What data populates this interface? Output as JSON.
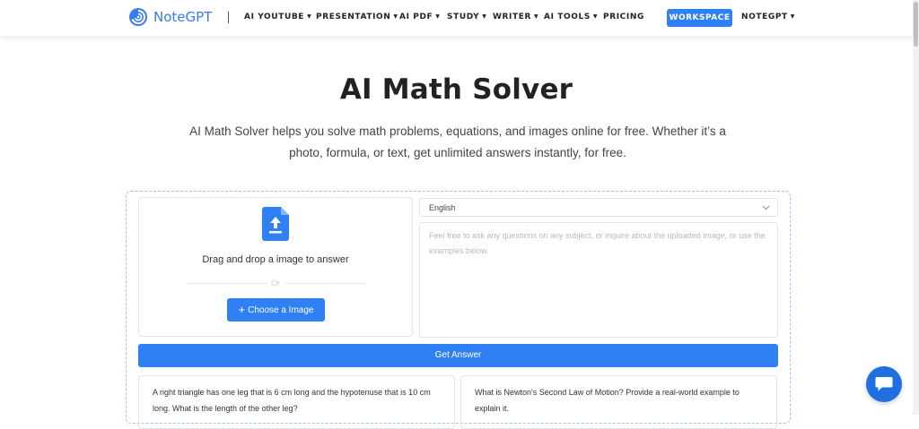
{
  "brand": {
    "name": "NoteGPT",
    "accent": "#2f80f5"
  },
  "nav": {
    "items": [
      {
        "label": "AI YOUTUBE",
        "dropdown": true
      },
      {
        "label": "PRESENTATION",
        "dropdown": true
      },
      {
        "label": "AI PDF",
        "dropdown": true
      },
      {
        "label": "STUDY",
        "dropdown": true
      },
      {
        "label": "WRITER",
        "dropdown": true
      },
      {
        "label": "AI TOOLS",
        "dropdown": true
      },
      {
        "label": "PRICING",
        "dropdown": false
      }
    ],
    "workspace_label": "WORKSPACE",
    "account_label": "NOTEGPT"
  },
  "hero": {
    "title": "AI Math Solver",
    "subtitle": "AI Math Solver helps you solve math problems, equations, and images online for free. Whether it’s a photo, formula, or text, get unlimited answers instantly, for free."
  },
  "upload": {
    "icon": "upload-file-icon",
    "drag_text": "Drag and drop a image to answer",
    "or_text": "Or",
    "choose_label": "Choose a Image"
  },
  "question": {
    "language": "English",
    "placeholder": "Feel free to ask any questions on any subject, or inquire about the uploaded image, or use the examples below."
  },
  "get_answer_label": "Get Answer",
  "examples": [
    {
      "text": "A right triangle has one leg that is 6 cm long and the hypotenuse that is 10 cm long. What is the length of the other leg?"
    },
    {
      "text": "What is Newton's Second Law of Motion? Provide a real-world example to explain it."
    }
  ],
  "chat": {
    "icon": "chat-bubble-icon"
  }
}
